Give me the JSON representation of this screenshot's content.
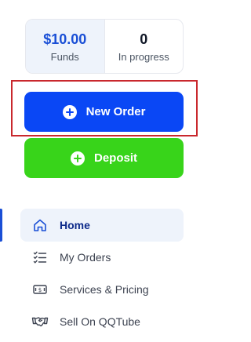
{
  "stats": {
    "funds_value": "$10.00",
    "funds_label": "Funds",
    "progress_value": "0",
    "progress_label": "In progress"
  },
  "actions": {
    "new_order_label": "New Order",
    "deposit_label": "Deposit"
  },
  "nav": {
    "items": [
      {
        "label": "Home",
        "icon": "home-icon",
        "active": true
      },
      {
        "label": "My Orders",
        "icon": "checklist-icon",
        "active": false
      },
      {
        "label": "Services & Pricing",
        "icon": "banknote-icon",
        "active": false
      },
      {
        "label": "Sell On QQTube",
        "icon": "handshake-icon",
        "active": false
      }
    ]
  },
  "colors": {
    "primary": "#0a47f5",
    "success": "#38d41a",
    "funds_text": "#1a4fd6",
    "highlight": "#c9282d",
    "active_bg": "#eef3fb"
  }
}
